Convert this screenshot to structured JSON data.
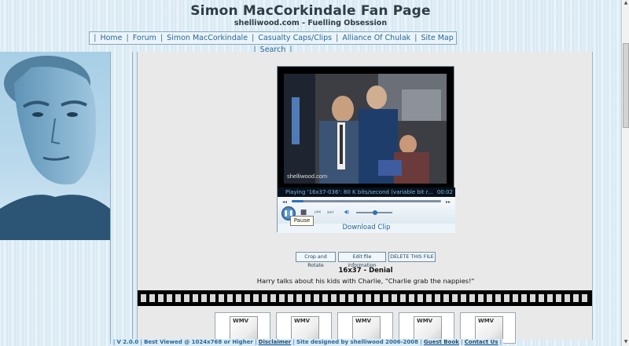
{
  "site": {
    "title": "Simon MacCorkindale Fan Page",
    "subtitle": "shelliwood.com - Fuelling Obsession"
  },
  "nav": {
    "items": [
      {
        "label": "Home"
      },
      {
        "label": "Forum"
      },
      {
        "label": "Simon MacCorkindale"
      },
      {
        "label": "Casualty Caps/Clips"
      },
      {
        "label": "Alliance Of Chulak"
      },
      {
        "label": "Site Map"
      },
      {
        "label": "Search"
      }
    ]
  },
  "player": {
    "watermark": "shelliwood.com",
    "status_text": "Playing '16x37-036': 80 K bits/second (variable bit r...",
    "time": "00:02",
    "tooltip": "Pause",
    "download_label": "Download Clip",
    "progress": 0.08,
    "volume": 0.45
  },
  "actions": {
    "crop": "Crop and Rotate",
    "edit": "Edit file information",
    "delete": "DELETE THIS FILE"
  },
  "clip": {
    "title": "16x37 - Denial",
    "description": "Harry talks about his kids with Charlie, \"Charlie grab the nappies!\""
  },
  "thumbs": [
    {
      "label": "WMV"
    },
    {
      "label": "WMV"
    },
    {
      "label": "WMV"
    },
    {
      "label": "WMV"
    },
    {
      "label": "WMV"
    }
  ],
  "footer": {
    "version": "V 2.0.0",
    "best_viewed": "Best Viewed @ 1024x768 or Higher",
    "disclaimer": "Disclaimer",
    "designed_by": "Site designed by shelliwood 2006-2008",
    "guest_book": "Guest Book",
    "contact": "Contact Us"
  },
  "colors": {
    "background": "#dfeef7",
    "link": "#2a6796",
    "title_text": "#2e3d46"
  }
}
